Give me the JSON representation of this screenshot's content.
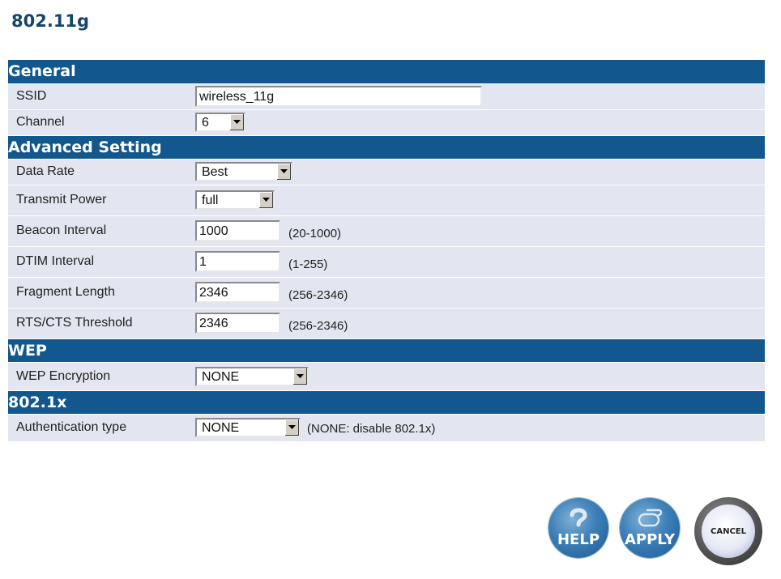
{
  "page_title": "802.11g",
  "sections": {
    "general": {
      "title": "General",
      "ssid_label": "SSID",
      "ssid_value": "wireless_11g",
      "channel_label": "Channel",
      "channel_value": "6"
    },
    "advanced": {
      "title": "Advanced Setting",
      "data_rate_label": "Data Rate",
      "data_rate_value": "Best",
      "transmit_power_label": "Transmit Power",
      "transmit_power_value": "full",
      "beacon_interval_label": "Beacon Interval",
      "beacon_interval_value": "1000",
      "beacon_interval_range": "(20-1000)",
      "dtim_interval_label": "DTIM Interval",
      "dtim_interval_value": "1",
      "dtim_interval_range": "(1-255)",
      "fragment_length_label": "Fragment Length",
      "fragment_length_value": "2346",
      "fragment_length_range": "(256-2346)",
      "rts_label": "RTS/CTS Threshold",
      "rts_value": "2346",
      "rts_range": "(256-2346)"
    },
    "wep": {
      "title": "WEP",
      "encryption_label": "WEP Encryption",
      "encryption_value": "NONE"
    },
    "dot1x": {
      "title": "802.1x",
      "auth_label": "Authentication type",
      "auth_value": "NONE",
      "auth_note": "(NONE: disable 802.1x)"
    }
  },
  "buttons": {
    "help": "HELP",
    "apply": "APPLY",
    "cancel": "CANCEL"
  },
  "colors": {
    "section_header": "#12578e",
    "row_background": "#e3e6f0",
    "title": "#14466b"
  }
}
